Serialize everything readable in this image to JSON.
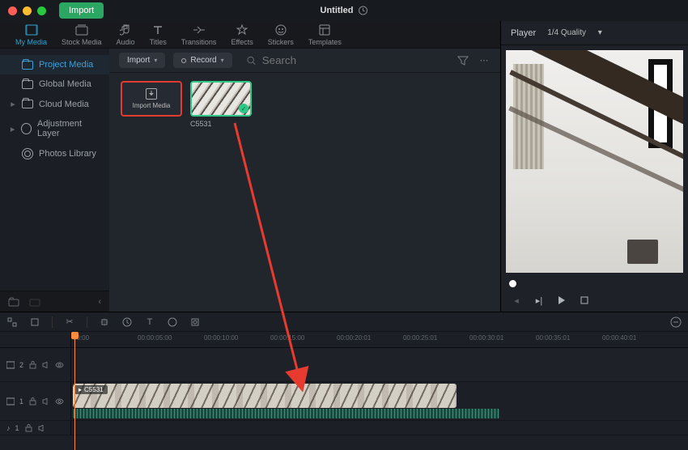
{
  "titlebar": {
    "import_btn": "Import",
    "doc_title": "Untitled"
  },
  "tabs": {
    "my_media": "My Media",
    "stock_media": "Stock Media",
    "audio": "Audio",
    "titles": "Titles",
    "transitions": "Transitions",
    "effects": "Effects",
    "stickers": "Stickers",
    "templates": "Templates"
  },
  "sidebar": {
    "project": "Project Media",
    "global": "Global Media",
    "cloud": "Cloud Media",
    "adjust": "Adjustment Layer",
    "photos": "Photos Library"
  },
  "toolbar": {
    "import": "Import",
    "record": "Record",
    "search_placeholder": "Search"
  },
  "thumbs": {
    "import_media": "Import Media",
    "clip_name": "C5531"
  },
  "player": {
    "label": "Player",
    "quality": "1/4 Quality"
  },
  "ruler": [
    "00:00",
    "00:00:05:00",
    "00:00:10:00",
    "00:00:15:00",
    "00:00:20:01",
    "00:00:25:01",
    "00:00:30:01",
    "00:00:35:01",
    "00:00:40:01"
  ],
  "tracks": {
    "v2": "2",
    "v1": "1",
    "a1": "1",
    "clip_tag": "C5531"
  }
}
